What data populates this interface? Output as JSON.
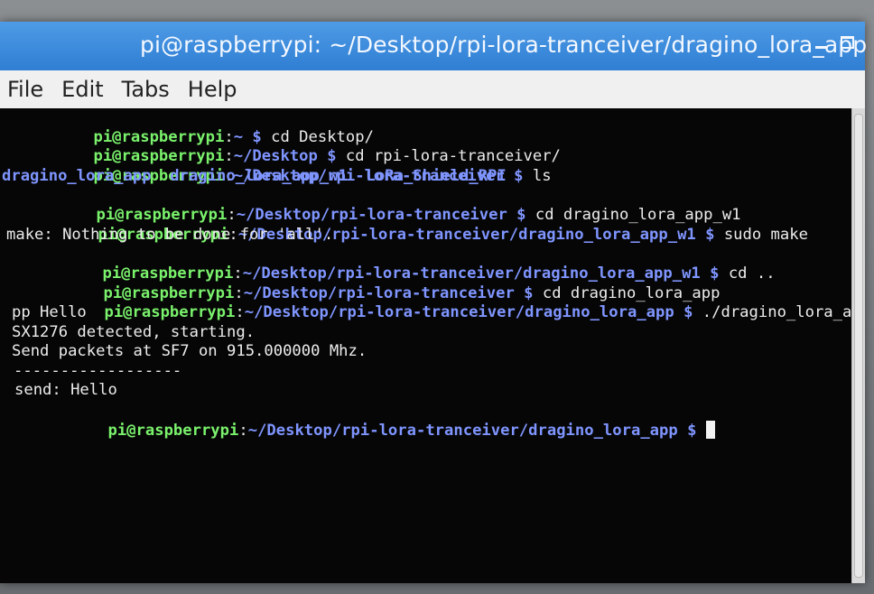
{
  "window": {
    "title": "pi@raspberrypi: ~/Desktop/rpi-lora-tranceiver/dragino_lora_app",
    "controls": {
      "minimize_icon": "minimize-icon",
      "maximize_icon": "maximize-icon"
    }
  },
  "menubar": {
    "items": [
      {
        "label": "File"
      },
      {
        "label": "Edit"
      },
      {
        "label": "Tabs"
      },
      {
        "label": "Help"
      }
    ]
  },
  "terminal": {
    "lines": [
      {
        "user": "pi@raspberrypi",
        "sep": ":",
        "path": "~ ",
        "prompt": "$ ",
        "command": "cd Desktop/"
      },
      {
        "user": "pi@raspberrypi",
        "sep": ":",
        "path": "~/Desktop ",
        "prompt": "$ ",
        "command": "cd rpi-lora-tranceiver/"
      },
      {
        "user": "pi@raspberrypi",
        "sep": ":",
        "path": "~/Desktop/rpi-lora-tranceiver ",
        "prompt": "$ ",
        "command": "ls"
      },
      {
        "output": "dragino_lora_app  dragino_lora_app_w1  LoRa_Shield_RPI"
      },
      {
        "user": "pi@raspberrypi",
        "sep": ":",
        "path": "~/Desktop/rpi-lora-tranceiver ",
        "prompt": "$ ",
        "command": "cd dragino_lora_app_w1"
      },
      {
        "user": "pi@raspberrypi",
        "sep": ":",
        "path": "~/Desktop/rpi-lora-tranceiver/dragino_lora_app_w1 ",
        "prompt": "$ ",
        "command": "sudo make"
      },
      {
        "output": "make: Nothing to be done for 'all'."
      },
      {
        "user": "pi@raspberrypi",
        "sep": ":",
        "path": "~/Desktop/rpi-lora-tranceiver/dragino_lora_app_w1 ",
        "prompt": "$ ",
        "command": "cd .."
      },
      {
        "user": "pi@raspberrypi",
        "sep": ":",
        "path": "~/Desktop/rpi-lora-tranceiver ",
        "prompt": "$ ",
        "command": "cd dragino_lora_app"
      },
      {
        "user": "pi@raspberrypi",
        "sep": ":",
        "path": "~/Desktop/rpi-lora-tranceiver/dragino_lora_app ",
        "prompt": "$ ",
        "command": "./dragino_lora_a"
      },
      {
        "output": "pp Hello"
      },
      {
        "output": "SX1276 detected, starting."
      },
      {
        "output": "Send packets at SF7 on 915.000000 Mhz."
      },
      {
        "output": "------------------"
      },
      {
        "output": "send: Hello"
      },
      {
        "user": "pi@raspberrypi",
        "sep": ":",
        "path": "~/Desktop/rpi-lora-tranceiver/dragino_lora_app ",
        "prompt": "$ ",
        "command": ""
      }
    ]
  },
  "scrollbar": {
    "thumb_icon": "scroll-thumb"
  }
}
